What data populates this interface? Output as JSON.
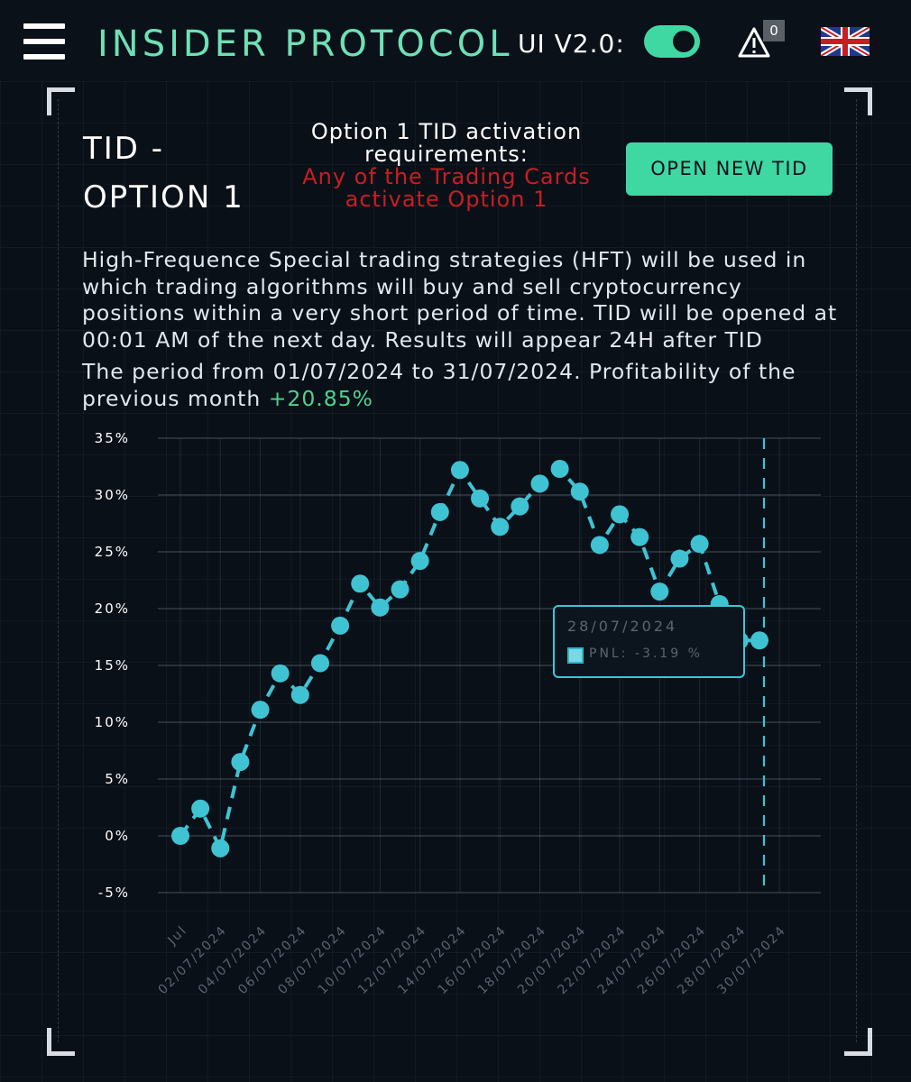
{
  "header": {
    "brand": "INSIDER  PROTOCOL",
    "ui_version": "UI V2.0:",
    "ui_toggle_on": true,
    "alert_count": "0",
    "language": "English",
    "accent_color": "#3fd8a3"
  },
  "panel": {
    "title_line1": "TID -",
    "title_line2": "OPTION 1",
    "requirements_title": "Option 1 TID activation requirements:",
    "requirements_detail": "Any of the Trading Cards activate Option 1",
    "open_button": "OPEN NEW TID",
    "description": "High-Frequence Special trading strategies (HFT) will be used in which trading algorithms will buy and sell cryptocurrency positions within a very short period of time. TID will be opened at 00:01 AM of the next day. Results will appear 24H after TID",
    "period_text": "The period from 01/07/2024 to 31/07/2024. Profitability of the previous month",
    "profitability": "+20.85%",
    "profitability_color": "#4fd28f"
  },
  "tooltip": {
    "date": "28/07/2024",
    "pnl_label": "PNL:",
    "pnl_value": "-3.19 %"
  },
  "chart_data": {
    "type": "line",
    "y_tick_labels": [
      "35%",
      "30%",
      "25%",
      "20%",
      "15%",
      "10%",
      "5%",
      "0%",
      "-5%"
    ],
    "ylim": [
      -5,
      35
    ],
    "x_tick_labels": [
      "Jul",
      "02/07/2024",
      "04/07/2024",
      "06/07/2024",
      "08/07/2024",
      "10/07/2024",
      "12/07/2024",
      "14/07/2024",
      "16/07/2024",
      "18/07/2024",
      "20/07/2024",
      "22/07/2024",
      "24/07/2024",
      "26/07/2024",
      "28/07/2024",
      "30/07/2024"
    ],
    "series": [
      {
        "color": "#3fc3d3",
        "x": [
          "01/07/2024",
          "02/07/2024",
          "03/07/2024",
          "04/07/2024",
          "05/07/2024",
          "06/07/2024",
          "07/07/2024",
          "08/07/2024",
          "09/07/2024",
          "10/07/2024",
          "11/07/2024",
          "12/07/2024",
          "13/07/2024",
          "14/07/2024",
          "15/07/2024",
          "16/07/2024",
          "17/07/2024",
          "18/07/2024",
          "19/07/2024",
          "20/07/2024",
          "21/07/2024",
          "22/07/2024",
          "23/07/2024",
          "24/07/2024",
          "25/07/2024",
          "26/07/2024",
          "27/07/2024",
          "28/07/2024",
          "29/07/2024",
          "30/07/2024"
        ],
        "values": [
          0.0,
          2.4,
          -1.1,
          6.5,
          11.1,
          14.3,
          12.4,
          15.2,
          18.5,
          22.2,
          20.1,
          21.7,
          24.2,
          28.5,
          32.2,
          29.7,
          27.2,
          29.0,
          31.0,
          32.3,
          30.3,
          25.6,
          28.3,
          26.3,
          21.5,
          24.4,
          25.7,
          20.4,
          17.2,
          17.2
        ]
      }
    ],
    "highlight_date": "30/07/2024",
    "grid": true
  }
}
